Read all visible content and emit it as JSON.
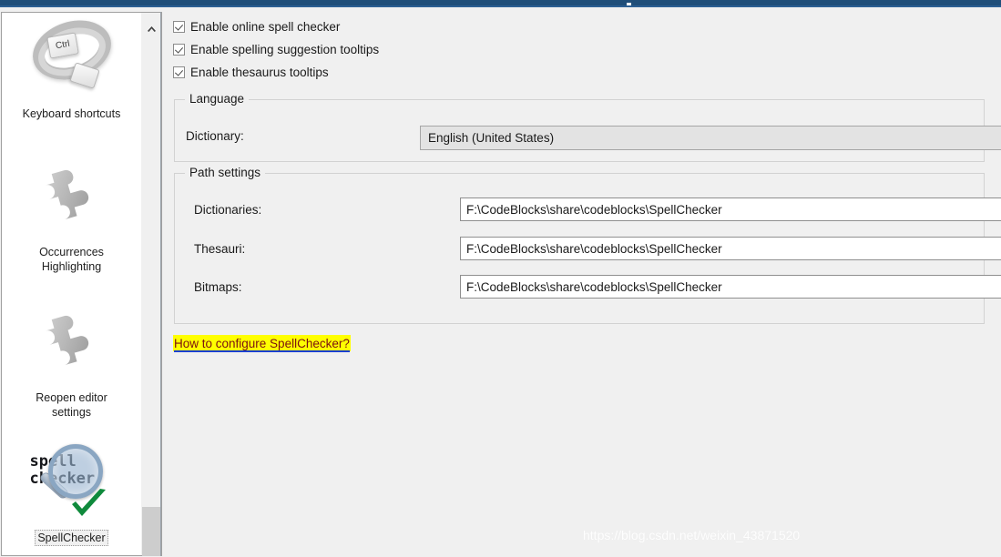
{
  "window": {
    "title_strip_color": "#1f4e79"
  },
  "sidebar": {
    "items": [
      {
        "label": "Keyboard shortcuts",
        "icon": "keyboard-shortcuts-icon",
        "selected": false
      },
      {
        "label": "Occurrences\nHighlighting",
        "label_line1": "Occurrences",
        "label_line2": "Highlighting",
        "icon": "puzzle-piece-icon",
        "selected": false
      },
      {
        "label": "Reopen editor settings",
        "label_line1": "Reopen editor",
        "label_line2": "settings",
        "icon": "puzzle-piece-icon",
        "selected": false
      },
      {
        "label": "SpellChecker",
        "icon": "spellchecker-icon",
        "selected": true
      }
    ],
    "icon_text": {
      "ctrl_key": "Ctrl",
      "spell_line1": "spell",
      "spell_line2": "checker"
    },
    "scrollbar": {
      "up_arrow": "chevron-up-icon"
    }
  },
  "main": {
    "checkboxes": [
      {
        "label": "Enable online spell checker",
        "checked": true
      },
      {
        "label": "Enable spelling suggestion tooltips",
        "checked": true
      },
      {
        "label": "Enable thesaurus tooltips",
        "checked": true
      }
    ],
    "language_group": {
      "legend": "Language",
      "dictionary_label": "Dictionary:",
      "dictionary_value": "English (United States)",
      "dropdown_icon": "chevron-down-icon"
    },
    "path_group": {
      "legend": "Path settings",
      "browse_label": "...",
      "rows": [
        {
          "label": "Dictionaries:",
          "value": "F:\\CodeBlocks\\share\\codeblocks\\SpellChecker"
        },
        {
          "label": "Thesauri:",
          "value": "F:\\CodeBlocks\\share\\codeblocks\\SpellChecker"
        },
        {
          "label": "Bitmaps:",
          "value": "F:\\CodeBlocks\\share\\codeblocks\\SpellChecker"
        }
      ]
    },
    "help_link": {
      "text": "How to configure SpellChecker?",
      "highlight_color": "#ffff00",
      "text_color": "#7a1010",
      "underline_color": "#1a3fd0"
    }
  },
  "watermark": {
    "text": "https://blog.csdn.net/weixin_43871520"
  }
}
